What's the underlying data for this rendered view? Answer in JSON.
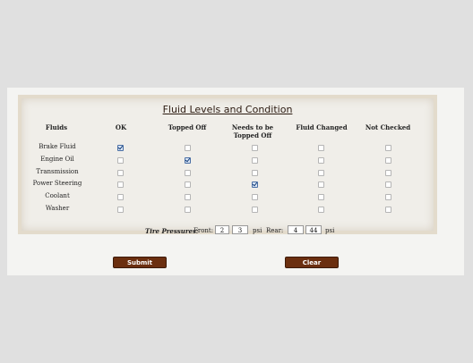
{
  "form": {
    "title": "Fluid Levels and Condition",
    "headers": {
      "fluids": "Fluids",
      "ok": "OK",
      "topped_off": "Topped Off",
      "needs_topped": "Needs to be Topped Off",
      "fluid_changed": "Fluid Changed",
      "not_checked": "Not Checked"
    },
    "rows": [
      {
        "label": "Brake Fluid",
        "checked": "ok"
      },
      {
        "label": "Engine Oil",
        "checked": "topped_off"
      },
      {
        "label": "Transmission",
        "checked": "none"
      },
      {
        "label": "Power Steering",
        "checked": "needs_topped"
      },
      {
        "label": "Coolant",
        "checked": "none"
      },
      {
        "label": "Washer",
        "checked": "none"
      }
    ],
    "tire": {
      "label": "Tire Pressures:",
      "front_label": "Front:",
      "front_a": "2",
      "front_b": "3",
      "unit": "psi",
      "rear_label": "Rear:",
      "rear_a": "4",
      "rear_b": "44"
    }
  },
  "buttons": {
    "submit": "Submit",
    "clear": "Clear"
  }
}
